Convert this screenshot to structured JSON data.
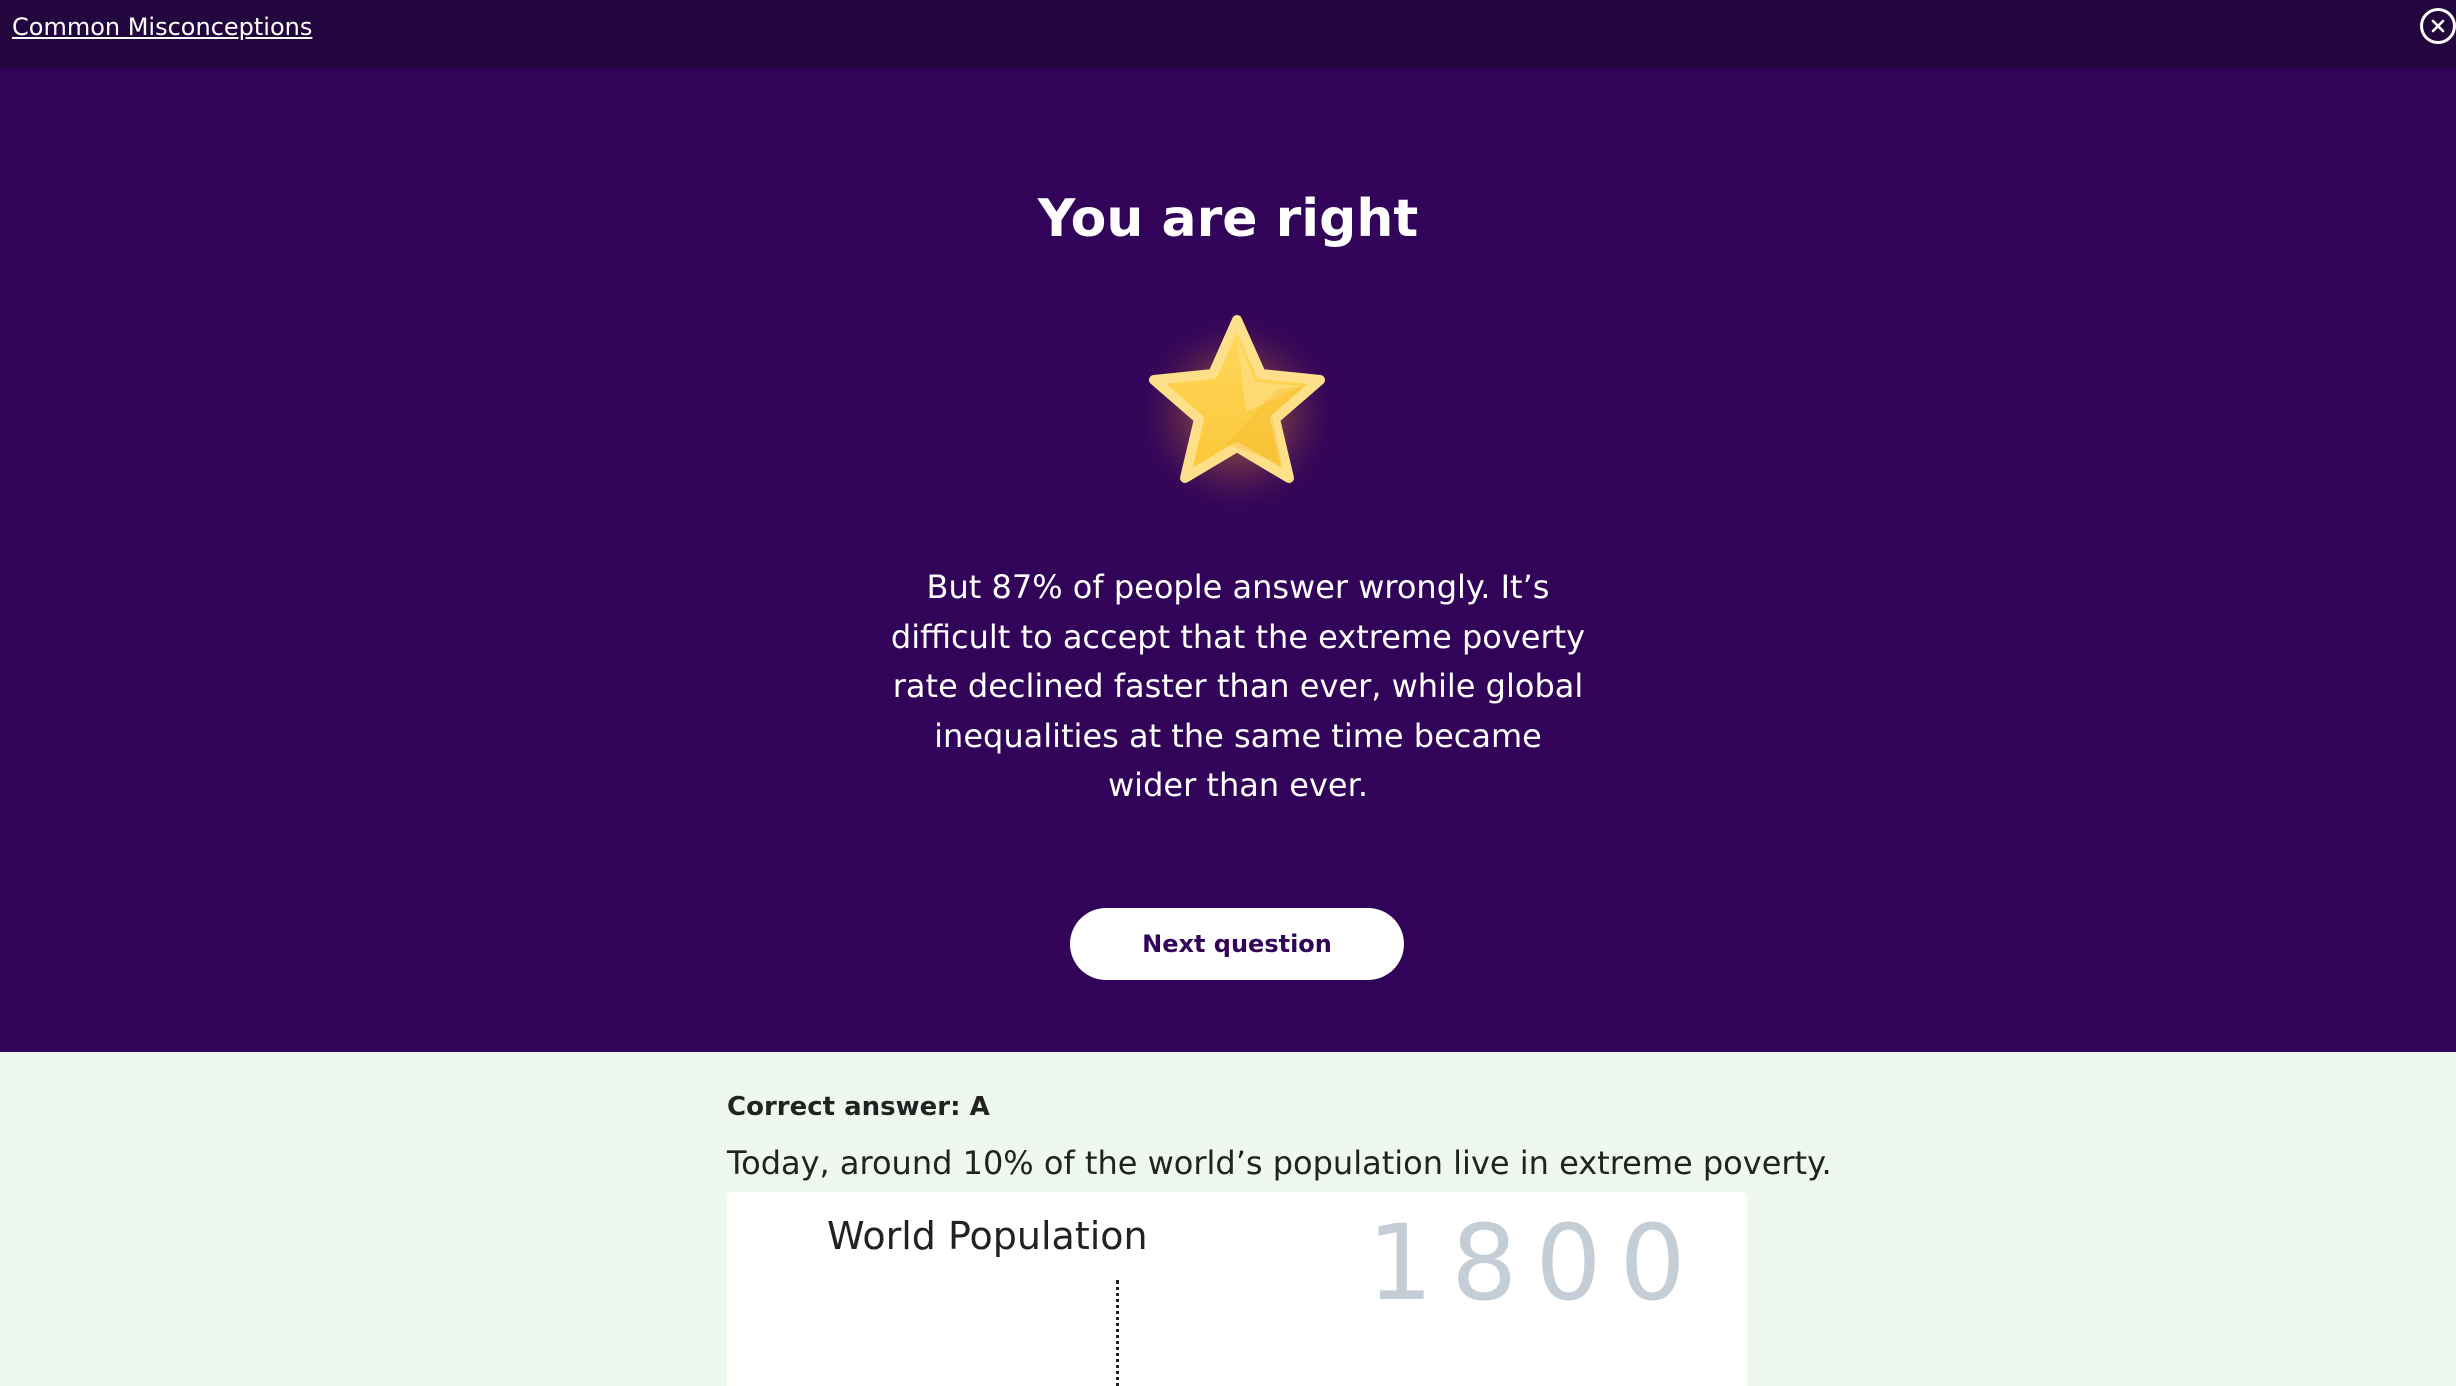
{
  "topbar": {
    "title_link": "Common Misconceptions",
    "close_icon": "close-circle-icon"
  },
  "result": {
    "title": "You are right",
    "icon": "star-icon",
    "star_color": "#FFD24D",
    "message": "But 87% of people answer wrongly. It’s difficult to accept that the extreme poverty rate declined faster than ever, while global inequalities at the same time became wider than ever.",
    "next_button": "Next question"
  },
  "answer": {
    "label": "Correct answer: A",
    "statement": "Today, around 10% of the world’s population live in extreme poverty."
  },
  "chart": {
    "title": "World Population",
    "year": "1800"
  },
  "colors": {
    "topbar_bg": "#24063F",
    "hero_bg": "#320459",
    "answer_bg": "#EEF8EE",
    "button_text": "#320459"
  }
}
